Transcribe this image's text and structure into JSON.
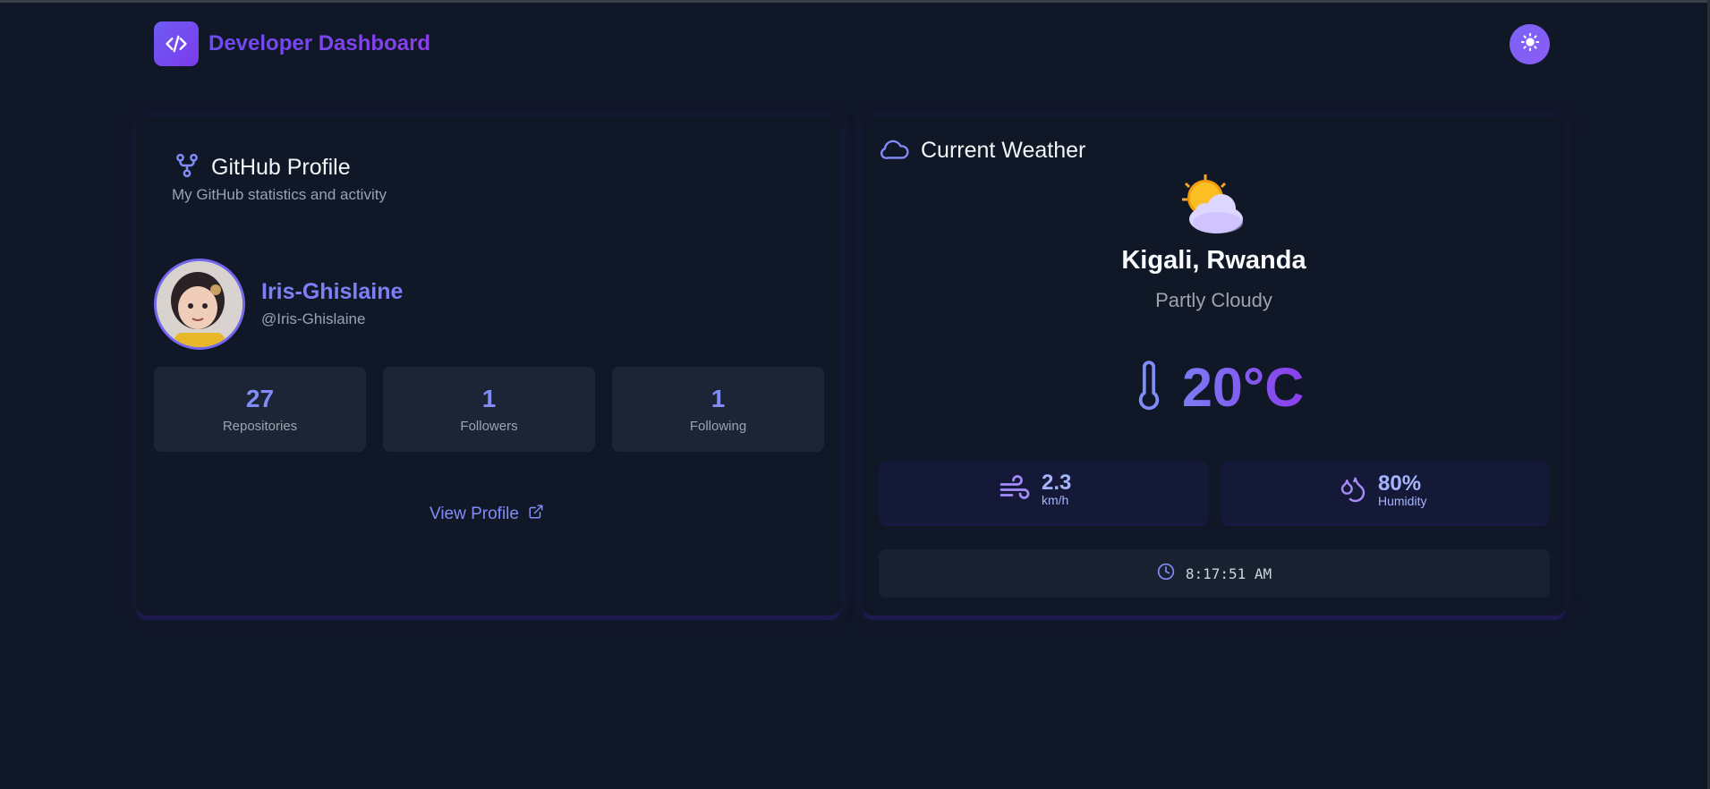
{
  "header": {
    "title": "Developer Dashboard",
    "logo_icon": "code-icon",
    "theme_toggle_icon": "sun-icon"
  },
  "github": {
    "title": "GitHub Profile",
    "subtitle": "My GitHub statistics and activity",
    "name": "Iris-Ghislaine",
    "handle": "@Iris-Ghislaine",
    "stats": [
      {
        "value": "27",
        "label": "Repositories"
      },
      {
        "value": "1",
        "label": "Followers"
      },
      {
        "value": "1",
        "label": "Following"
      }
    ],
    "view_profile": "View Profile"
  },
  "weather": {
    "title": "Current Weather",
    "city": "Kigali, Rwanda",
    "condition": "Partly Cloudy",
    "temperature": "20°C",
    "wind_value": "2.3",
    "wind_unit": "km/h",
    "humidity_value": "80%",
    "humidity_label": "Humidity",
    "time": "8:17:51 AM"
  },
  "colors": {
    "background": "#101727",
    "card": "#101828",
    "accent": "#7c3aed",
    "indigo": "#818cf8"
  }
}
